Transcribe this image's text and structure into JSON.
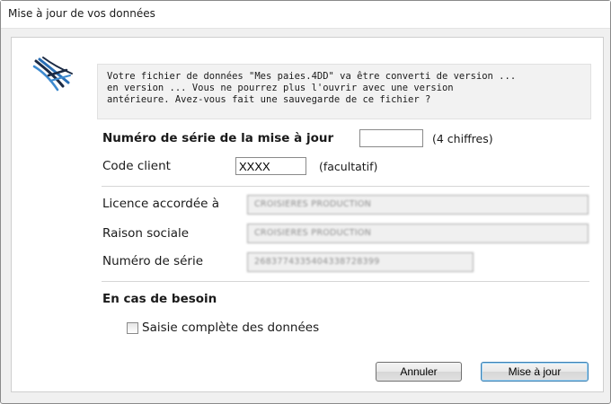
{
  "window": {
    "title": "Mise à jour de vos données"
  },
  "message": "Votre fichier de données \"Mes paies.4DD\" va être converti de version ...\nen version ...  Vous ne pourrez plus l'ouvrir avec une version\nantérieure. Avez-vous fait une sauvegarde de ce fichier ?",
  "form": {
    "serial_update_label": "Numéro de série de la mise à jour",
    "serial_update_value": "",
    "serial_update_hint": "(4 chiffres)",
    "client_code_label": "Code client",
    "client_code_value": "XXXX",
    "client_code_hint": "(facultatif)",
    "license_label": "Licence accordée à",
    "license_value": "CROISIERES PRODUCTION",
    "company_label": "Raison sociale",
    "company_value": "CROISIERES PRODUCTION",
    "serial_label": "Numéro de série",
    "serial_value": "2683774335404338728399"
  },
  "help": {
    "heading": "En cas de besoin",
    "checkbox_label": "Saisie complète des données",
    "checkbox_checked": false
  },
  "buttons": {
    "cancel": "Annuler",
    "update": "Mise à jour"
  }
}
